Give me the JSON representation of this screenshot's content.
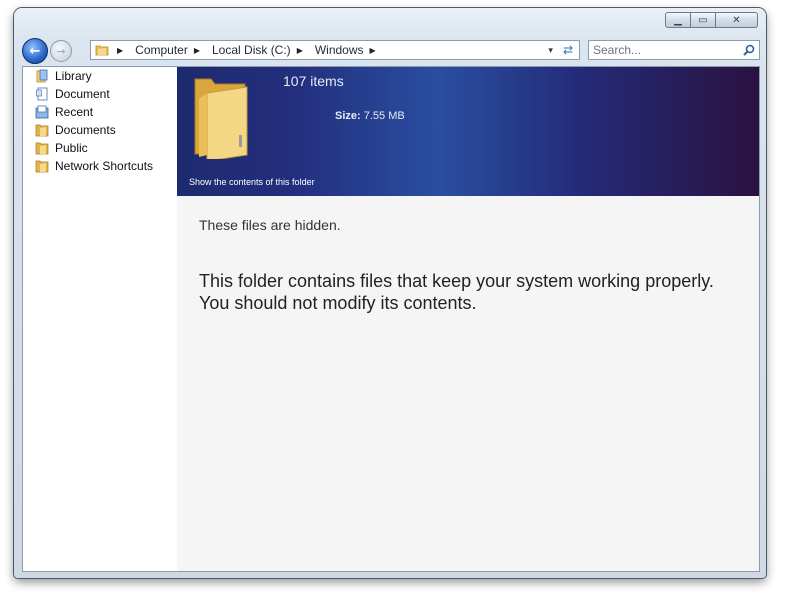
{
  "window": {
    "controls": {
      "minimize": "▁",
      "maximize": "▭",
      "close": "✕"
    }
  },
  "navigation": {
    "back_icon": "back-arrow-icon",
    "forward_icon": "forward-arrow-icon"
  },
  "address_bar": {
    "breadcrumbs": [
      "Computer",
      "Local Disk (C:)",
      "Windows"
    ],
    "dropdown_glyph": "▾",
    "refresh_glyph": "⇄"
  },
  "search": {
    "placeholder": "Search..."
  },
  "sidebar": {
    "items": [
      {
        "label": "Library",
        "icon": "library-icon"
      },
      {
        "label": "Document",
        "icon": "document-icon"
      },
      {
        "label": "Recent",
        "icon": "recent-icon"
      },
      {
        "label": "Documents",
        "icon": "folder-icon"
      },
      {
        "label": "Public",
        "icon": "folder-icon"
      },
      {
        "label": "Network Shortcuts",
        "icon": "folder-icon"
      }
    ]
  },
  "folder_info": {
    "items_count": "107 items",
    "size_label": "Size:",
    "size_value": "7.55 MB",
    "show_contents_link": "Show the contents of this folder"
  },
  "message": {
    "hidden_note": "These files are hidden.",
    "warning": "This folder contains files that keep your system working properly. You should not modify its contents."
  },
  "colors": {
    "header_band_dark": "#1e2a6e",
    "header_band_mid": "#2a4ea0",
    "header_band_end": "#2a1240",
    "folder_yellow": "#f2d27a",
    "accent_blue": "#2a64c8"
  }
}
